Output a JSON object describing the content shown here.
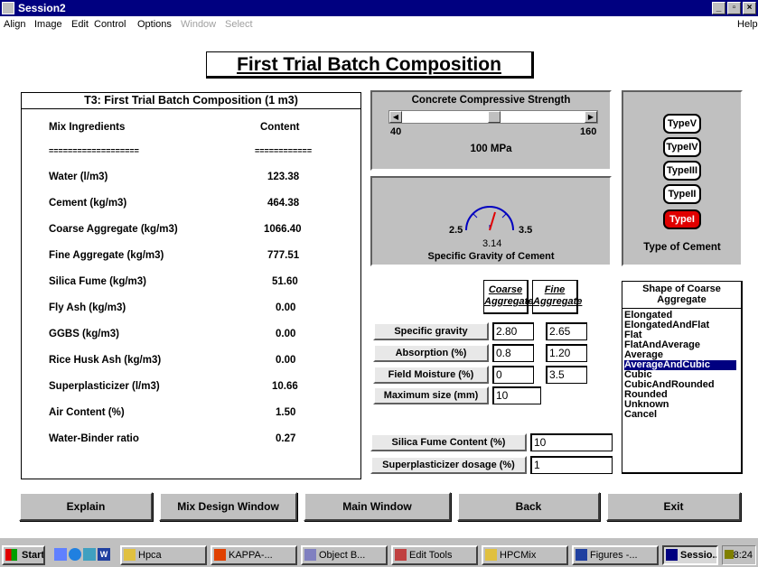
{
  "window": {
    "title": "Session2"
  },
  "menu": [
    "Align",
    "Image",
    "Edit",
    "Control",
    "Options",
    "Window",
    "Select"
  ],
  "menu_help": "Help",
  "page_title": "First Trial Batch Composition",
  "table": {
    "title": "T3: First Trial Batch Composition (1 m3)",
    "col_ingredients": "Mix Ingredients",
    "col_content": "Content",
    "sep_left": "===================",
    "sep_right": "============",
    "rows": [
      {
        "label": "Water (l/m3)",
        "value": "123.38"
      },
      {
        "label": "Cement (kg/m3)",
        "value": "464.38"
      },
      {
        "label": "Coarse Aggregate (kg/m3)",
        "value": "1066.40"
      },
      {
        "label": "Fine Aggregate (kg/m3)",
        "value": "777.51"
      },
      {
        "label": "Silica Fume (kg/m3)",
        "value": "51.60"
      },
      {
        "label": "Fly Ash (kg/m3)",
        "value": "0.00"
      },
      {
        "label": "GGBS (kg/m3)",
        "value": "0.00"
      },
      {
        "label": "Rice Husk Ash (kg/m3)",
        "value": "0.00"
      },
      {
        "label": "Superplasticizer (l/m3)",
        "value": "10.66"
      },
      {
        "label": "Air Content (%)",
        "value": "1.50"
      },
      {
        "label": "Water-Binder ratio",
        "value": "0.27"
      }
    ]
  },
  "strength": {
    "title": "Concrete Compressive Strength",
    "min": "40",
    "max": "160",
    "value_label": "100 MPa",
    "value": 100
  },
  "gravity": {
    "min": "2.5",
    "max": "3.5",
    "value": "3.14",
    "label": "Specific Gravity of Cement"
  },
  "cement": {
    "types": [
      "TypeV",
      "TypeIV",
      "TypeIII",
      "TypeII",
      "TypeI"
    ],
    "selected": "TypeI",
    "label": "Type of Cement"
  },
  "aggregate": {
    "col_coarse_1": "Coarse",
    "col_coarse_2": "Aggregate",
    "col_fine_1": "Fine",
    "col_fine_2": "Aggregate",
    "specific_gravity_label": "Specific gravity",
    "specific_gravity_coarse": "2.80",
    "specific_gravity_fine": "2.65",
    "absorption_label": "Absorption (%)",
    "absorption_coarse": "0.8",
    "absorption_fine": "1.20",
    "moisture_label": "Field Moisture (%)",
    "moisture_coarse": "0",
    "moisture_fine": "3.5",
    "max_size_label": "Maximum size (mm)",
    "max_size_coarse": "10"
  },
  "silica_fume": {
    "label": "Silica Fume Content (%)",
    "value": "10"
  },
  "superplasticizer": {
    "label": "Superplasticizer dosage (%)",
    "value": "1"
  },
  "shape": {
    "title_1": "Shape of Coarse",
    "title_2": "Aggregate",
    "items": [
      "Elongated",
      "ElongatedAndFlat",
      "Flat",
      "FlatAndAverage",
      "Average",
      "AverageAndCubic",
      "Cubic",
      "CubicAndRounded",
      "Rounded",
      "Unknown",
      "Cancel"
    ],
    "selected_index": 5
  },
  "buttons": {
    "explain": "Explain",
    "mix_design": "Mix Design Window",
    "main": "Main Window",
    "back": "Back",
    "exit": "Exit"
  },
  "taskbar": {
    "start": "Start",
    "tasks": [
      "Hpca",
      "KAPPA-...",
      "Object B...",
      "Edit Tools",
      "HPCMix",
      "Figures -...",
      "Sessio..."
    ],
    "time": "18:24"
  },
  "colors": {
    "titlebar": "#000080",
    "selected_cement": "#e00000",
    "panel": "#c0c0c0",
    "list_selection": "#000080"
  }
}
